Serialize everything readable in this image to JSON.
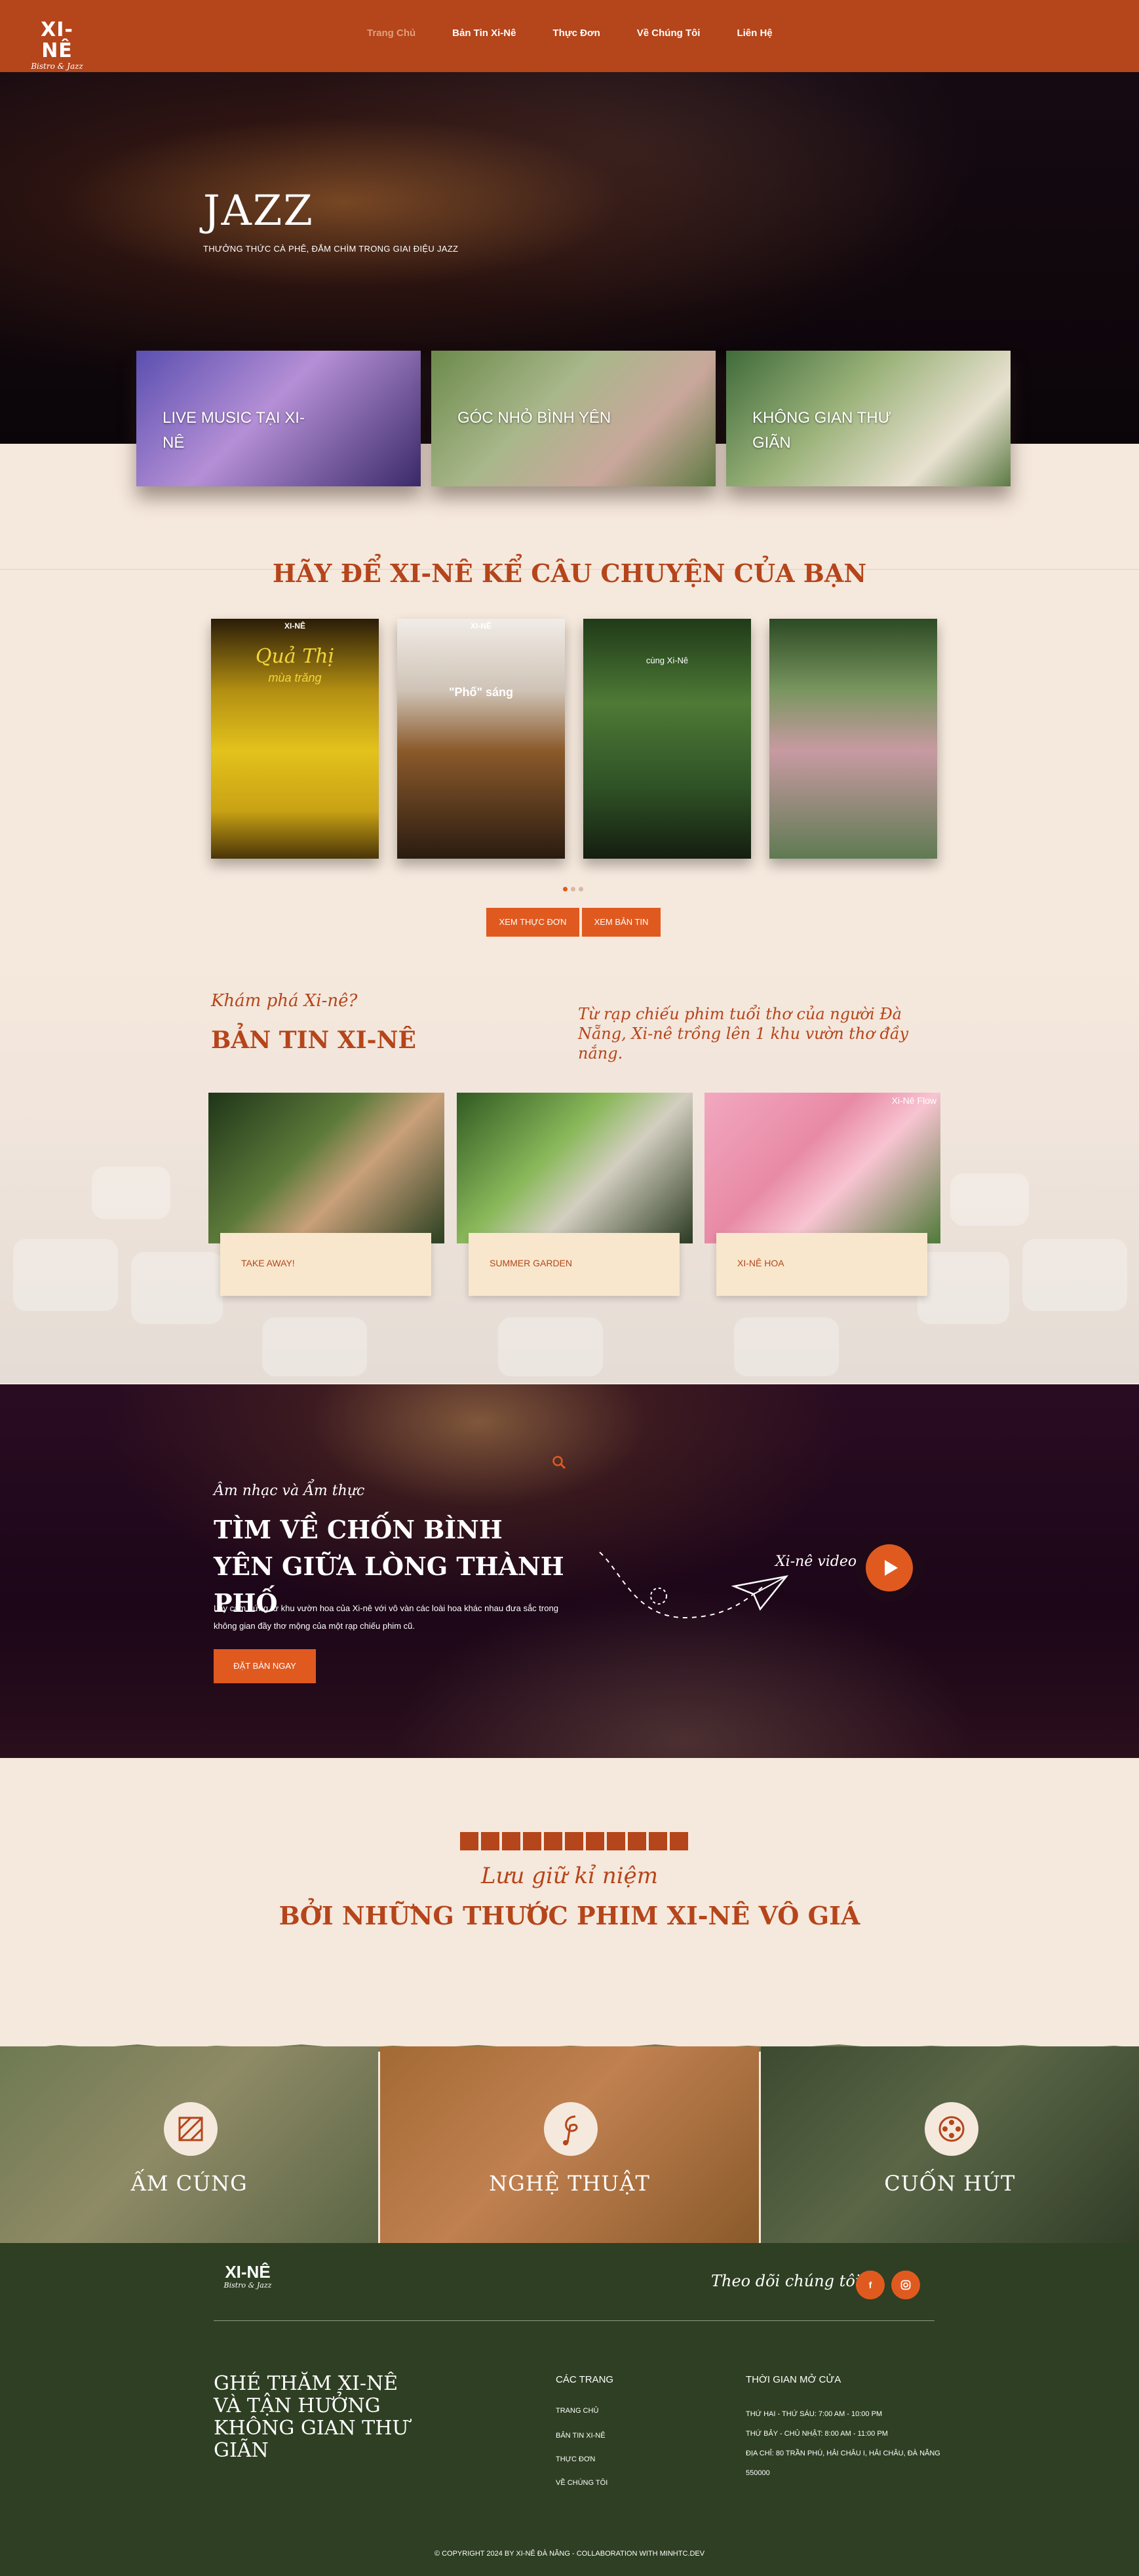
{
  "header": {
    "logo_main": "XI-NÊ",
    "logo_sub": "Bistro & Jazz",
    "nav": [
      {
        "label": "Trang Chủ",
        "active": true
      },
      {
        "label": "Bản Tin Xi-Nê",
        "active": false
      },
      {
        "label": "Thực Đơn",
        "active": false
      },
      {
        "label": "Về Chúng Tôi",
        "active": false
      },
      {
        "label": "Liên Hệ",
        "active": false
      }
    ]
  },
  "hero": {
    "title": "JAZZ",
    "subtitle": "THƯỞNG THỨC CÀ PHÊ, ĐẮM CHÌM TRONG GIAI ĐIỆU JAZZ",
    "cards": [
      "LIVE MUSIC TẠI XI-NÊ",
      "GÓC NHỎ BÌNH YÊN",
      "KHÔNG GIAN THƯ GIÃN"
    ]
  },
  "stories": {
    "title": "HÃY ĐỂ XI-NÊ KỂ CÂU CHUYỆN CỦA BẠN",
    "cards": [
      {
        "brand": "XI-NÊ",
        "title": "Quả Thị",
        "subtitle": "mùa trăng"
      },
      {
        "brand": "XI-NÊ",
        "title": "",
        "subtitle": "\"Phố\" sáng"
      },
      {
        "brand": "",
        "title": "",
        "subtitle": "cùng Xi-Nê"
      },
      {
        "brand": "",
        "title": "",
        "subtitle": ""
      }
    ],
    "btn_menu": "XEM THỰC ĐƠN",
    "btn_news": "XEM BẢN TIN"
  },
  "news": {
    "kicker": "Khám phá Xi-nê?",
    "title": "BẢN TIN XI-NÊ",
    "quote": "Từ rạp chiếu phim tuổi thơ của người Đà Nẵng, Xi-nê trồng lên 1 khu vườn thơ đầy nắng.",
    "cards": [
      "TAKE AWAY!",
      "SUMMER GARDEN",
      "XI-NÊ HOA"
    ],
    "card3_tag": "Xi-Nê Flow"
  },
  "dark": {
    "kicker": "Âm nhạc và Ẩm thực",
    "title_1": "TÌM VỀ CHỐN BÌNH",
    "title_2": "YÊN GIỮA LÒNG THÀNH PHỐ",
    "desc": "Lấy cảm hứng từ khu vườn hoa của Xi-nê với vô vàn các loài hoa khác nhau đưa sắc trong không gian đầy thơ mộng của một rạp chiếu phim cũ.",
    "button": "ĐẶT BÀN NGAY",
    "video_label": "Xi-nê video"
  },
  "memories": {
    "kicker": "Lưu giữ kỉ niệm",
    "title": "BỞI NHỮNG THƯỚC PHIM XI-NÊ VÔ GIÁ",
    "panels": [
      "ẤM CÚNG",
      "NGHỆ THUẬT",
      "CUỐN HÚT"
    ]
  },
  "footer": {
    "logo_main": "XI-NÊ",
    "logo_sub": "Bistro & Jazz",
    "follow": "Theo dõi chúng tôi",
    "slogan": "GHÉ THĂM XI-NÊ VÀ TẬN HƯỞNG KHÔNG GIAN THƯ GIÃN",
    "links_title": "CÁC TRANG",
    "links": [
      "TRANG CHỦ",
      "BẢN TIN XI-NÊ",
      "THỰC ĐƠN",
      "VỀ CHÚNG TÔI"
    ],
    "hours_title": "THỜI GIAN MỞ CỬA",
    "hours_1": "THỨ HAI - THỨ SÁU: 7:00 AM - 10:00 PM",
    "hours_2": "THỨ BẢY - CHỦ NHẬT: 8:00 AM - 11:00 PM",
    "address": "ĐỊA CHỈ: 80 TRẦN PHÚ, HẢI CHÂU I, HẢI CHÂU, ĐÀ NẴNG 550000",
    "copyright": "© COPYRIGHT 2024 BY XI-NÊ ĐÀ NẴNG - COLLABORATION WITH MINHTC.DEV"
  },
  "colors": {
    "brand": "#b5451b",
    "accent": "#e05a20",
    "background": "#f5e8dc",
    "footer": "#2f3f23"
  },
  "icons": [
    "play-icon",
    "search-icon",
    "facebook-icon",
    "instagram-icon",
    "paper-plane-icon"
  ]
}
